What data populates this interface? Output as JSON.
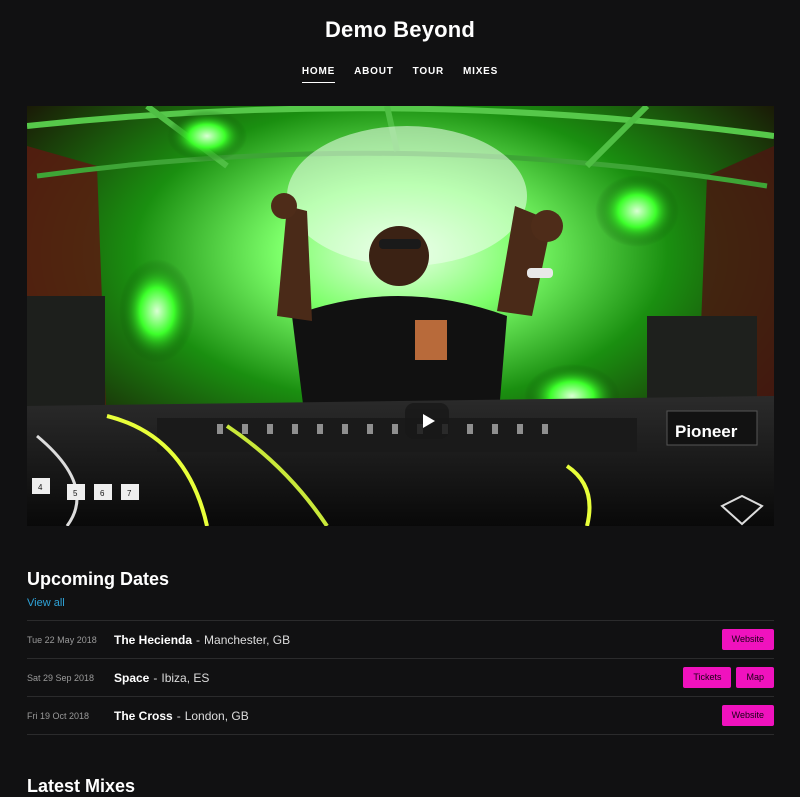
{
  "site": {
    "title": "Demo Beyond"
  },
  "nav": {
    "items": [
      "HOME",
      "ABOUT",
      "TOUR",
      "MIXES"
    ],
    "active": "HOME"
  },
  "hero": {
    "media": "video",
    "play_icon": "play-icon",
    "logo_text": "Pioneer",
    "deck_numbers": [
      "4",
      "5",
      "6",
      "7"
    ]
  },
  "upcoming": {
    "title": "Upcoming Dates",
    "view_all": "View all",
    "events": [
      {
        "date": "Tue 22 May 2018",
        "venue": "The Hecienda",
        "location": "Manchester, GB",
        "buttons": [
          "Website"
        ]
      },
      {
        "date": "Sat 29 Sep 2018",
        "venue": "Space",
        "location": "Ibiza, ES",
        "buttons": [
          "Tickets",
          "Map"
        ]
      },
      {
        "date": "Fri 19 Oct 2018",
        "venue": "The Cross",
        "location": "London, GB",
        "buttons": [
          "Website"
        ]
      }
    ],
    "separator": "-"
  },
  "latest": {
    "title": "Latest Mixes"
  },
  "colors": {
    "background": "#111112",
    "accent": "#f012be",
    "link": "#2fa3d8",
    "divider": "#2b2b2c"
  }
}
